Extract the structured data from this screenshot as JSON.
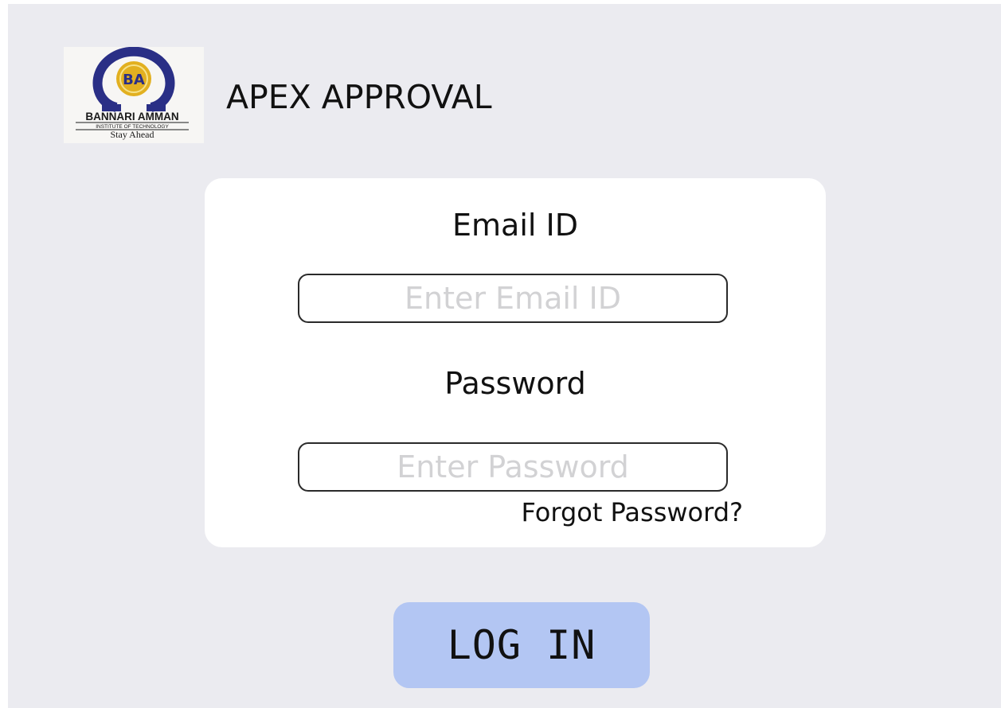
{
  "header": {
    "app_title": "APEX APPROVAL",
    "logo": {
      "icon": "institute-logo",
      "name": "BANNARI AMMAN",
      "subtitle": "INSTITUTE OF TECHNOLOGY",
      "tagline": "Stay Ahead",
      "monogram": "BA",
      "colors": {
        "navy": "#2a2f86",
        "gold": "#e2b020"
      }
    }
  },
  "login_form": {
    "email_label": "Email ID",
    "email_placeholder": "Enter Email ID",
    "email_value": "",
    "password_label": "Password",
    "password_placeholder": "Enter Password",
    "password_value": "",
    "forgot_link": "Forgot Password?"
  },
  "actions": {
    "login_label": "LOG IN"
  },
  "colors": {
    "background": "#ebebf0",
    "card": "#ffffff",
    "login_button": "#b3c6f3"
  }
}
